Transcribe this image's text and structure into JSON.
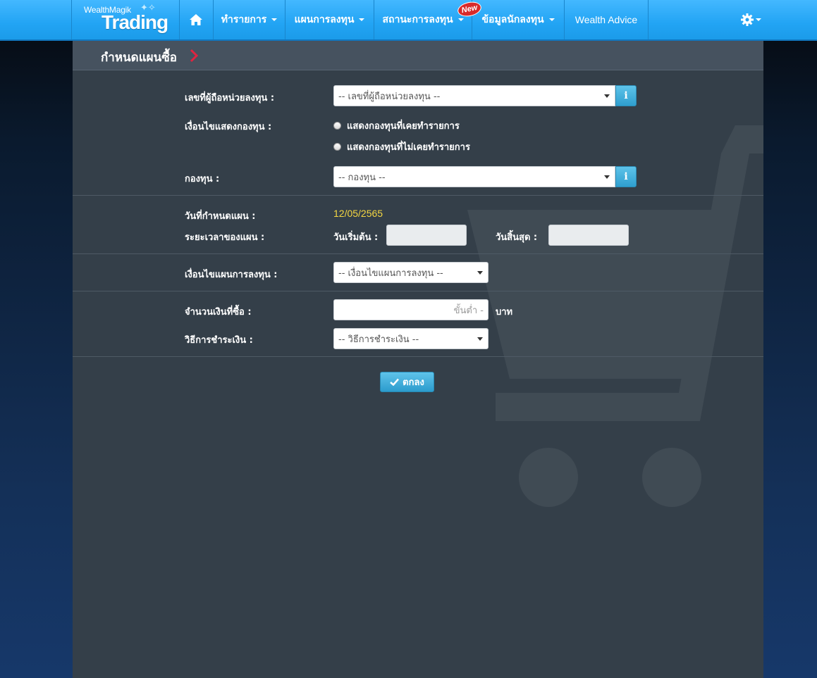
{
  "brand": {
    "small": "WealthMagik",
    "big": "Trading"
  },
  "nav": {
    "items": [
      {
        "label": "ทำรายการ"
      },
      {
        "label": "แผนการลงทุน"
      },
      {
        "label": "สถานะการลงทุน"
      },
      {
        "label": "ข้อมูลนักลงทุน"
      },
      {
        "label": "Wealth Advice"
      }
    ],
    "new_badge": "New"
  },
  "page": {
    "title": "กำหนดแผนซื้อ"
  },
  "form": {
    "holder_label": "เลขที่ผู้ถือหน่วยลงทุน :",
    "holder_select": "-- เลขที่ผู้ถือหน่วยลงทุน --",
    "fund_condition_label": "เงื่อนไขแสดงกองทุน :",
    "radio_traded": "แสดงกองทุนที่เคยทำรายการ",
    "radio_not_traded": "แสดงกองทุนที่ไม่เคยทำรายการ",
    "fund_label": "กองทุน :",
    "fund_select": "-- กองทุน --",
    "plan_date_label": "วันที่กำหนดแผน :",
    "plan_date_value": "12/05/2565",
    "duration_label": "ระยะเวลาของแผน :",
    "start_label": "วันเริ่มต้น :",
    "end_label": "วันสิ้นสุด :",
    "plan_condition_label": "เงื่อนไขแผนการลงทุน :",
    "plan_condition_select": "-- เงื่อนไขแผนการลงทุน --",
    "amount_label": "จำนวนเงินที่ซื้อ :",
    "amount_placeholder": "ขั้นต่ำ -",
    "amount_unit": "บาท",
    "payment_label": "วิธีการชำระเงิน :",
    "payment_select": "-- วิธีการชำระเงิน --",
    "ok_label": "ตกลง"
  },
  "icons": {
    "home": "home-icon",
    "gear": "gear-icon",
    "info": "info-icon",
    "check": "check-icon",
    "cart": "cart-icon"
  },
  "colors": {
    "nav_bg": "#22a4f4",
    "panel_bg": "#343f49",
    "header_bg": "#46525f",
    "accent_date": "#f5d742",
    "button": "#2c9ccd",
    "chevron": "#e02440"
  }
}
